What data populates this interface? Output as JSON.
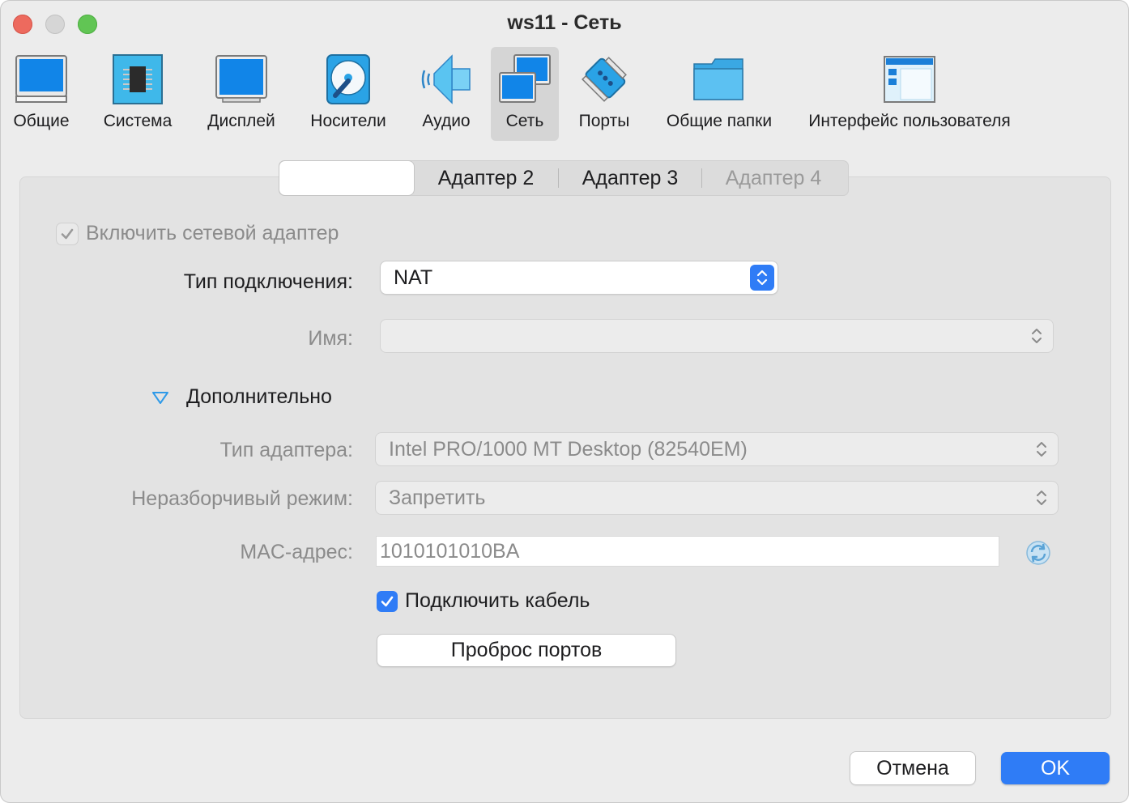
{
  "window": {
    "title": "ws11 - Сеть"
  },
  "toolbar": [
    {
      "label": "Общие",
      "icon": "general-icon"
    },
    {
      "label": "Система",
      "icon": "system-chip-icon"
    },
    {
      "label": "Дисплей",
      "icon": "display-icon"
    },
    {
      "label": "Носители",
      "icon": "storage-disk-icon"
    },
    {
      "label": "Аудио",
      "icon": "audio-speaker-icon"
    },
    {
      "label": "Сеть",
      "icon": "network-icon",
      "active": true
    },
    {
      "label": "Порты",
      "icon": "ports-icon"
    },
    {
      "label": "Общие папки",
      "icon": "shared-folder-icon"
    },
    {
      "label": "Интерфейс пользователя",
      "icon": "user-interface-icon"
    }
  ],
  "tabs": [
    {
      "label": "",
      "selected": true
    },
    {
      "label": "Адаптер 2"
    },
    {
      "label": "Адаптер 3"
    },
    {
      "label": "Адаптер 4",
      "disabled": true
    }
  ],
  "adapter": {
    "enable_label": "Включить сетевой адаптер",
    "enable_checked": true,
    "attached_label": "Тип подключения:",
    "attached_value": "NAT",
    "name_label": "Имя:",
    "name_value": "",
    "advanced_label": "Дополнительно",
    "adapter_type_label": "Тип адаптера:",
    "adapter_type_value": "Intel PRO/1000 MT Desktop (82540EM)",
    "promisc_label": "Неразборчивый режим:",
    "promisc_value": "Запретить",
    "mac_label": "MAC-адрес:",
    "mac_value": "1010101010BA",
    "cable_label": "Подключить кабель",
    "cable_checked": true,
    "port_forwarding_label": "Проброс портов"
  },
  "footer": {
    "cancel_label": "Отмена",
    "ok_label": "OK"
  },
  "colors": {
    "accent": "#2f7cf6",
    "panel": "#e3e3e3",
    "window": "#ececec"
  }
}
